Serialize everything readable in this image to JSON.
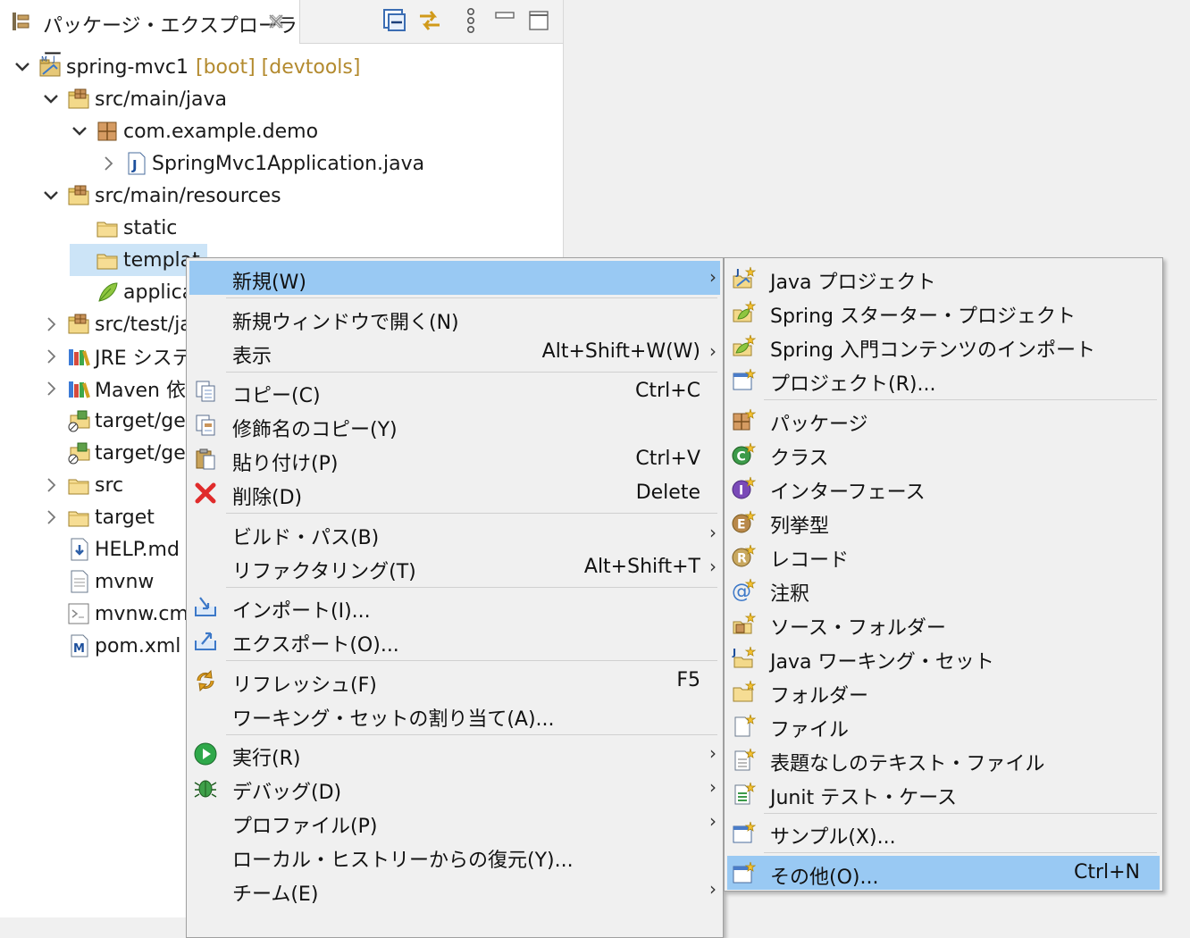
{
  "view": {
    "tab_title": "パッケージ・エクスプローラー"
  },
  "tree": [
    {
      "label": "spring-mvc1",
      "decor": "[boot] [devtools]",
      "twisty": "open",
      "indent": 0,
      "icon": "project-icon"
    },
    {
      "label": "src/main/java",
      "twisty": "open",
      "indent": 1,
      "icon": "source-folder-icon"
    },
    {
      "label": "com.example.demo",
      "twisty": "open",
      "indent": 2,
      "icon": "package-icon"
    },
    {
      "label": "SpringMvc1Application.java",
      "twisty": "closed",
      "indent": 3,
      "icon": "java-file-icon"
    },
    {
      "label": "src/main/resources",
      "twisty": "open",
      "indent": 1,
      "icon": "source-folder-icon"
    },
    {
      "label": "static",
      "twisty": "none",
      "indent": 2,
      "icon": "folder-icon"
    },
    {
      "label": "templat",
      "twisty": "none",
      "indent": 2,
      "icon": "folder-icon",
      "selected": true
    },
    {
      "label": "applica",
      "twisty": "none",
      "indent": 2,
      "icon": "properties-file-icon"
    },
    {
      "label": "src/test/ja",
      "twisty": "closed",
      "indent": 1,
      "icon": "source-folder-icon"
    },
    {
      "label": "JRE システ",
      "twisty": "closed",
      "indent": 1,
      "icon": "library-icon"
    },
    {
      "label": "Maven 依",
      "twisty": "closed",
      "indent": 1,
      "icon": "library-icon"
    },
    {
      "label": "target/ge",
      "twisty": "none",
      "indent": 1,
      "icon": "generated-folder-icon"
    },
    {
      "label": "target/ge",
      "twisty": "none",
      "indent": 1,
      "icon": "generated-folder-icon"
    },
    {
      "label": "src",
      "twisty": "closed",
      "indent": 1,
      "icon": "folder-icon"
    },
    {
      "label": "target",
      "twisty": "closed",
      "indent": 1,
      "icon": "folder-icon"
    },
    {
      "label": "HELP.md",
      "twisty": "none",
      "indent": 1,
      "icon": "markdown-file-icon"
    },
    {
      "label": "mvnw",
      "twisty": "none",
      "indent": 1,
      "icon": "text-file-icon"
    },
    {
      "label": "mvnw.cm",
      "twisty": "none",
      "indent": 1,
      "icon": "script-file-icon"
    },
    {
      "label": "pom.xml",
      "twisty": "none",
      "indent": 1,
      "icon": "maven-pom-icon"
    }
  ],
  "context_menu": [
    {
      "label": "新規(W)",
      "arrow": true,
      "highlighted": true,
      "icon": ""
    },
    {
      "sep": true
    },
    {
      "label": "新規ウィンドウで開く(N)",
      "icon": ""
    },
    {
      "label": "表示",
      "accel": "Alt+Shift+W(W)",
      "arrow": true,
      "icon": ""
    },
    {
      "sep": true
    },
    {
      "label": "コピー(C)",
      "accel": "Ctrl+C",
      "icon": "copy-icon"
    },
    {
      "label": "修飾名のコピー(Y)",
      "icon": "copy-qualified-icon"
    },
    {
      "label": "貼り付け(P)",
      "accel": "Ctrl+V",
      "icon": "paste-icon"
    },
    {
      "label": "削除(D)",
      "accel": "Delete",
      "icon": "delete-icon"
    },
    {
      "sep": true
    },
    {
      "label": "ビルド・パス(B)",
      "arrow": true,
      "icon": ""
    },
    {
      "label": "リファクタリング(T)",
      "accel": "Alt+Shift+T",
      "arrow": true,
      "icon": ""
    },
    {
      "sep": true
    },
    {
      "label": "インポート(I)...",
      "icon": "import-icon"
    },
    {
      "label": "エクスポート(O)...",
      "icon": "export-icon"
    },
    {
      "sep": true
    },
    {
      "label": "リフレッシュ(F)",
      "accel": "F5",
      "icon": "refresh-icon"
    },
    {
      "label": "ワーキング・セットの割り当て(A)...",
      "icon": ""
    },
    {
      "sep": true
    },
    {
      "label": "実行(R)",
      "arrow": true,
      "icon": "run-icon"
    },
    {
      "label": "デバッグ(D)",
      "arrow": true,
      "icon": "debug-icon"
    },
    {
      "label": "プロファイル(P)",
      "arrow": true,
      "icon": ""
    },
    {
      "label": "ローカル・ヒストリーからの復元(Y)...",
      "icon": ""
    },
    {
      "label": "チーム(E)",
      "arrow": true,
      "icon": ""
    }
  ],
  "submenu": [
    {
      "label": "Java プロジェクト",
      "icon": "new-java-project-icon"
    },
    {
      "label": "Spring スターター・プロジェクト",
      "icon": "new-spring-project-icon"
    },
    {
      "label": "Spring 入門コンテンツのインポート",
      "icon": "spring-import-icon"
    },
    {
      "label": "プロジェクト(R)...",
      "icon": "new-project-icon"
    },
    {
      "sep": true
    },
    {
      "label": "パッケージ",
      "icon": "new-package-icon"
    },
    {
      "label": "クラス",
      "icon": "new-class-icon"
    },
    {
      "label": "インターフェース",
      "icon": "new-interface-icon"
    },
    {
      "label": "列挙型",
      "icon": "new-enum-icon"
    },
    {
      "label": "レコード",
      "icon": "new-record-icon"
    },
    {
      "label": "注釈",
      "icon": "new-annotation-icon"
    },
    {
      "label": "ソース・フォルダー",
      "icon": "new-source-folder-icon"
    },
    {
      "label": "Java ワーキング・セット",
      "icon": "new-working-set-icon"
    },
    {
      "label": "フォルダー",
      "icon": "new-folder-icon"
    },
    {
      "label": "ファイル",
      "icon": "new-file-icon"
    },
    {
      "label": "表題なしのテキスト・ファイル",
      "icon": "new-untitled-text-icon"
    },
    {
      "label": "Junit テスト・ケース",
      "icon": "new-junit-icon"
    },
    {
      "sep": true
    },
    {
      "label": "サンプル(X)...",
      "icon": "new-example-icon"
    },
    {
      "sep": true
    },
    {
      "label": "その他(O)...",
      "accel": "Ctrl+N",
      "highlighted": true,
      "icon": "new-other-icon"
    }
  ]
}
